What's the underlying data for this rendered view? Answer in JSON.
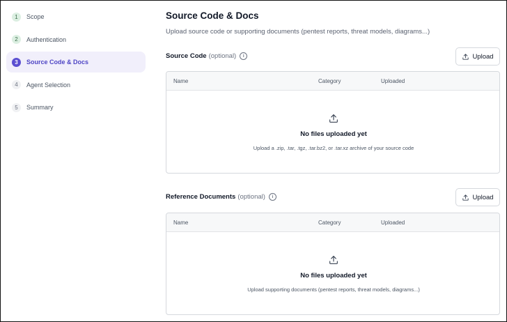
{
  "steps": [
    {
      "num": "1",
      "label": "Scope",
      "state": "done"
    },
    {
      "num": "2",
      "label": "Authentication",
      "state": "done"
    },
    {
      "num": "3",
      "label": "Source Code & Docs",
      "state": "active"
    },
    {
      "num": "4",
      "label": "Agent Selection",
      "state": "pending"
    },
    {
      "num": "5",
      "label": "Summary",
      "state": "pending"
    }
  ],
  "page": {
    "title": "Source Code & Docs",
    "subtitle": "Upload source code or supporting documents (pentest reports, threat models, diagrams...)"
  },
  "source_code": {
    "title": "Source Code",
    "optional": "(optional)",
    "upload_label": "Upload",
    "columns": {
      "name": "Name",
      "category": "Category",
      "uploaded": "Uploaded"
    },
    "empty_title": "No files uploaded yet",
    "empty_desc": "Upload a .zip, .tar, .tgz, .tar.bz2, or .tar.xz archive of your source code"
  },
  "reference_docs": {
    "title": "Reference Documents",
    "optional": "(optional)",
    "upload_label": "Upload",
    "columns": {
      "name": "Name",
      "category": "Category",
      "uploaded": "Uploaded"
    },
    "empty_title": "No files uploaded yet",
    "empty_desc": "Upload supporting documents (pentest reports, threat models, diagrams...)"
  },
  "icons": {
    "upload": "upload-icon",
    "info": "info-icon"
  },
  "colors": {
    "accent": "#5b4fd1",
    "active_bg": "#f1effb",
    "done_badge": "#dcefe2"
  }
}
